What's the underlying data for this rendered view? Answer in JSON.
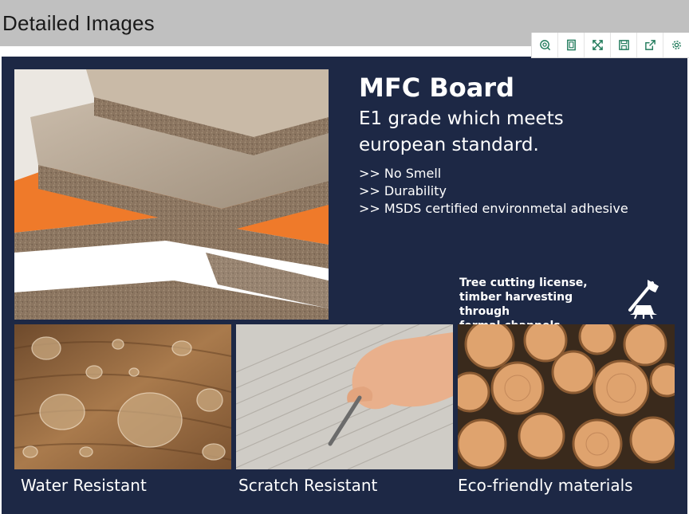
{
  "header": {
    "title": "Detailed Images"
  },
  "toolbar": {
    "buttons": [
      {
        "icon": "zoom-icon"
      },
      {
        "icon": "copy-icon"
      },
      {
        "icon": "fullscreen-icon"
      },
      {
        "icon": "save-icon"
      },
      {
        "icon": "share-icon"
      },
      {
        "icon": "settings-icon"
      }
    ]
  },
  "banner": {
    "title": "MFC Board",
    "subtitle": "E1 grade which meets european standard.",
    "features": [
      ">> No Smell",
      ">> Durability",
      ">> MSDS certified environmetal adhesive"
    ],
    "license_lines": [
      "Tree cutting license,",
      "timber harvesting through",
      "formal channels"
    ],
    "captions": [
      "Water Resistant",
      "Scratch Resistant",
      "Eco-friendly materials"
    ],
    "colors": {
      "background": "#1d2845",
      "accent_orange": "#ef7a2a"
    }
  }
}
